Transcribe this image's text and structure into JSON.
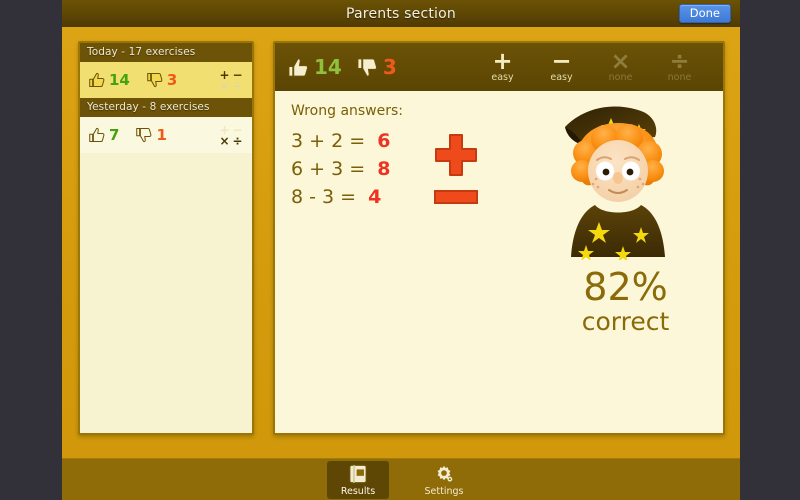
{
  "window": {
    "title": "Parents section",
    "done_label": "Done"
  },
  "sidebar": {
    "sessions": [
      {
        "header": "Today - 17 exercises",
        "correct": "14",
        "wrong": "3",
        "selected": true,
        "ops": [
          {
            "symbol": "+",
            "active": true
          },
          {
            "symbol": "−",
            "active": true
          },
          {
            "symbol": "×",
            "active": false
          },
          {
            "symbol": "÷",
            "active": false
          }
        ]
      },
      {
        "header": "Yesterday - 8 exercises",
        "correct": "7",
        "wrong": "1",
        "selected": false,
        "ops": [
          {
            "symbol": "+",
            "active": false
          },
          {
            "symbol": "−",
            "active": false
          },
          {
            "symbol": "×",
            "active": true
          },
          {
            "symbol": "÷",
            "active": true
          }
        ]
      }
    ]
  },
  "panel": {
    "toolbar": {
      "correct": "14",
      "wrong": "3",
      "ops": [
        {
          "symbol": "+",
          "level": "easy",
          "active": true
        },
        {
          "symbol": "−",
          "level": "easy",
          "active": true
        },
        {
          "symbol": "×",
          "level": "none",
          "active": false
        },
        {
          "symbol": "÷",
          "level": "none",
          "active": false
        }
      ]
    },
    "wrong_answers_title": "Wrong answers:",
    "wrong_answer_groups": [
      {
        "operation": "plus",
        "equations": [
          {
            "problem": "3 + 2 =",
            "answer": "6"
          },
          {
            "problem": "6 + 3 =",
            "answer": "8"
          }
        ]
      },
      {
        "operation": "minus",
        "equations": [
          {
            "problem": "8 - 3 =",
            "answer": "4"
          }
        ]
      }
    ],
    "score_percent": "82%",
    "score_label": "correct"
  },
  "tabbar": {
    "tabs": [
      {
        "label": "Results",
        "icon": "book-icon",
        "selected": true
      },
      {
        "label": "Settings",
        "icon": "gear-icon",
        "selected": false
      }
    ]
  },
  "colors": {
    "accent_gold": "#d79e10",
    "dark_brown": "#5d4604",
    "cream": "#fbf7d8",
    "good_green": "#46a310",
    "bad_orange": "#ef5a18",
    "answer_red": "#ee3322",
    "done_blue": "#3e79d6"
  }
}
